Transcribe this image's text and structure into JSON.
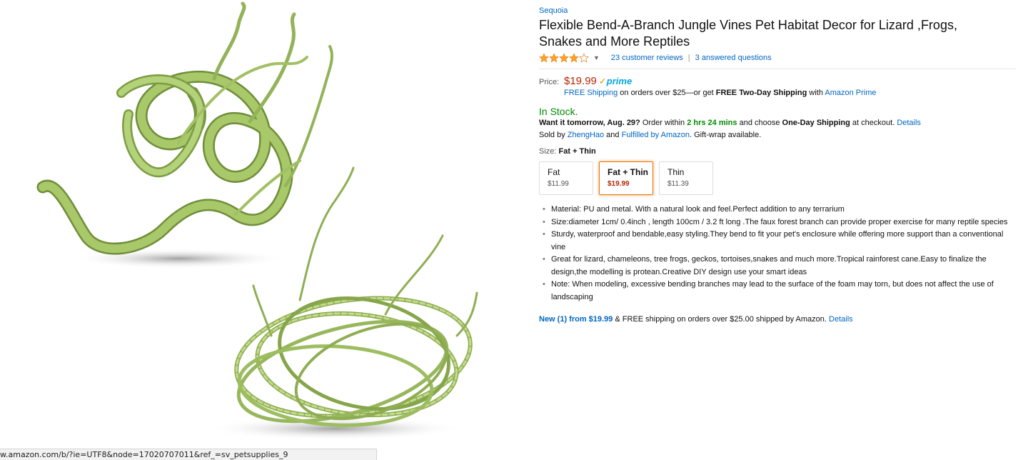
{
  "product": {
    "brand": "Sequoia",
    "title": "Flexible Bend-A-Branch Jungle Vines Pet Habitat Decor for Lizard ,Frogs, Snakes and More Reptiles",
    "rating": 4,
    "rating_max": 5,
    "reviews_label": "23 customer reviews",
    "questions_label": "3 answered questions"
  },
  "price": {
    "label": "Price:",
    "value": "$19.99",
    "prime_check": "✓",
    "prime_word": "prime",
    "free_shipping_link": "FREE Shipping",
    "shipping_text": " on orders over $25—or get ",
    "two_day": "FREE Two-Day Shipping",
    "with_text": " with ",
    "amazon_prime": "Amazon Prime"
  },
  "availability": {
    "status": "In Stock.",
    "want_it": "Want it tomorrow, Aug. 29?",
    "order_within": " Order within ",
    "countdown": "2 hrs 24 mins",
    "choose": " and choose ",
    "one_day": "One-Day Shipping",
    "at_checkout": " at checkout. ",
    "details": "Details",
    "sold_by": "Sold by ",
    "seller": "ZhengHao",
    "and": " and ",
    "fulfilled": "Fulfilled by Amazon",
    "gift": ". Gift-wrap available."
  },
  "size": {
    "label": "Size: ",
    "selected": "Fat + Thin",
    "options": [
      {
        "name": "Fat",
        "price": "$11.99"
      },
      {
        "name": "Fat + Thin",
        "price": "$19.99"
      },
      {
        "name": "Thin",
        "price": "$11.39"
      }
    ]
  },
  "bullets": [
    "Material: PU and metal. With a natural look and feel.Perfect addition to any terrarium",
    "Size:diameter 1cm/ 0.4inch , length 100cm / 3.2 ft long .The faux forest branch can provide proper exercise for many reptile species",
    "Sturdy, waterproof and bendable,easy styling.They bend to fit your pet's enclosure while offering more support than a conventional vine",
    "Great for lizard, chameleons, tree frogs, geckos, tortoises,snakes and much more.Tropical rainforest cane.Easy to finalize the design,the modelling is protean.Creative DIY design use your smart ideas",
    "Note: When modeling, excessive bending branches may lead to the surface of the foam may torn, but does not affect the use of landscaping"
  ],
  "offers": {
    "new_link": "New (1) from $19.99",
    "text": " & FREE shipping on orders over $25.00 shipped by Amazon. ",
    "details": "Details"
  },
  "status_bar": {
    "url": "w.amazon.com/b/?ie=UTF8&node=17020707011&ref_=sv_petsupplies_9"
  },
  "colors": {
    "link": "#0066c0",
    "price": "#b12704",
    "instock": "#008a00",
    "star": "#ffa41c",
    "vine": "#a8c86a"
  }
}
